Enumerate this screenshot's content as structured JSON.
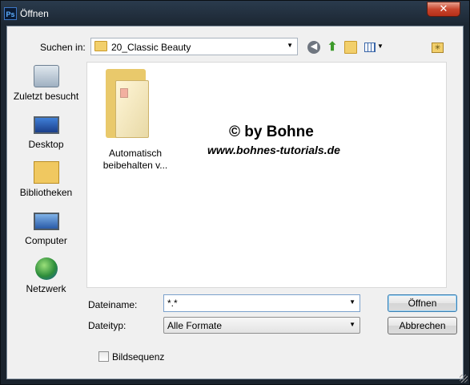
{
  "window": {
    "title": "Öffnen",
    "app_icon_text": "Ps",
    "close_glyph": "✕"
  },
  "toolbar": {
    "look_in_label": "Suchen in:",
    "look_in_value": "20_Classic Beauty",
    "icons": [
      "back-icon",
      "up-folder-icon",
      "new-folder-icon",
      "view-menu-icon",
      "favorites-icon"
    ]
  },
  "places": [
    {
      "label": "Zuletzt besucht",
      "icon": "recent-places-icon"
    },
    {
      "label": "Desktop",
      "icon": "desktop-icon"
    },
    {
      "label": "Bibliotheken",
      "icon": "libraries-icon"
    },
    {
      "label": "Computer",
      "icon": "computer-icon"
    },
    {
      "label": "Netzwerk",
      "icon": "network-icon"
    }
  ],
  "files": [
    {
      "name_line1": "Automatisch",
      "name_line2": "beibehalten v...",
      "icon": "folder-icon"
    }
  ],
  "watermark": {
    "line1": "© by Bohne",
    "line2": "www.bohnes-tutorials.de"
  },
  "form": {
    "filename_label": "Dateiname:",
    "filename_value": "*.*",
    "filetype_label": "Dateityp:",
    "filetype_value": "Alle Formate",
    "open_button": "Öffnen",
    "cancel_button": "Abbrechen",
    "sequence_label": "Bildsequenz",
    "sequence_checked": false
  }
}
